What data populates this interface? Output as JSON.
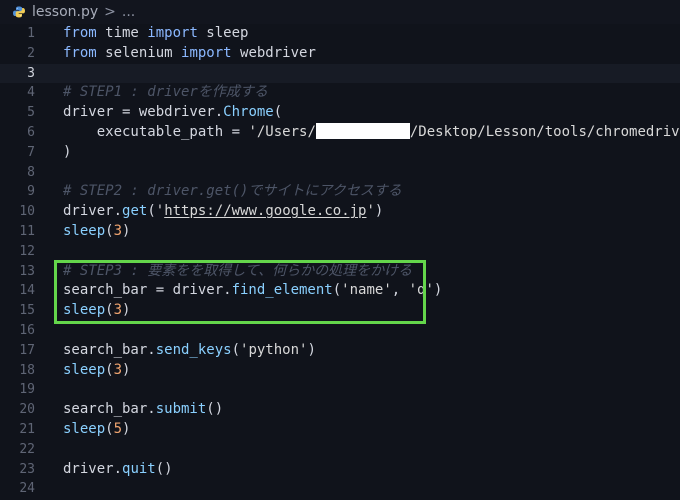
{
  "breadcrumb": {
    "file_name": "lesson.py",
    "separator": ">",
    "more": "..."
  },
  "editor": {
    "current_line": 3,
    "lines": [
      {
        "n": "1",
        "tokens": [
          {
            "t": "from",
            "c": "kw"
          },
          {
            "t": " time ",
            "c": "plain"
          },
          {
            "t": "import",
            "c": "kw"
          },
          {
            "t": " sleep",
            "c": "plain"
          }
        ]
      },
      {
        "n": "2",
        "tokens": [
          {
            "t": "from",
            "c": "kw"
          },
          {
            "t": " selenium ",
            "c": "plain"
          },
          {
            "t": "import",
            "c": "kw"
          },
          {
            "t": " webdriver",
            "c": "plain"
          }
        ]
      },
      {
        "n": "3",
        "tokens": [
          {
            "t": "",
            "c": "plain"
          }
        ]
      },
      {
        "n": "4",
        "tokens": [
          {
            "t": "# STEP1 : driverを作成する",
            "c": "cm"
          }
        ]
      },
      {
        "n": "5",
        "tokens": [
          {
            "t": "driver = webdriver.",
            "c": "plain"
          },
          {
            "t": "Chrome",
            "c": "fn"
          },
          {
            "t": "(",
            "c": "plain"
          }
        ]
      },
      {
        "n": "6",
        "tokens": [
          {
            "t": "    executable_path = ",
            "c": "plain"
          },
          {
            "t": "'/Users/",
            "c": "str"
          },
          {
            "t": "[REDACTED]",
            "c": "redact"
          },
          {
            "t": "/Desktop/Lesson/tools/chromedriver'",
            "c": "str"
          }
        ]
      },
      {
        "n": "7",
        "tokens": [
          {
            "t": ")",
            "c": "plain"
          }
        ]
      },
      {
        "n": "8",
        "tokens": [
          {
            "t": "",
            "c": "plain"
          }
        ]
      },
      {
        "n": "9",
        "tokens": [
          {
            "t": "# STEP2 : driver.get()でサイトにアクセスする",
            "c": "cm"
          }
        ]
      },
      {
        "n": "10",
        "tokens": [
          {
            "t": "driver.",
            "c": "plain"
          },
          {
            "t": "get",
            "c": "fn"
          },
          {
            "t": "(",
            "c": "plain"
          },
          {
            "t": "'",
            "c": "str"
          },
          {
            "t": "https://www.google.co.jp",
            "c": "url"
          },
          {
            "t": "'",
            "c": "str"
          },
          {
            "t": ")",
            "c": "plain"
          }
        ]
      },
      {
        "n": "11",
        "tokens": [
          {
            "t": "sleep",
            "c": "fn"
          },
          {
            "t": "(",
            "c": "plain"
          },
          {
            "t": "3",
            "c": "num"
          },
          {
            "t": ")",
            "c": "plain"
          }
        ]
      },
      {
        "n": "12",
        "tokens": [
          {
            "t": "",
            "c": "plain"
          }
        ]
      },
      {
        "n": "13",
        "tokens": [
          {
            "t": "# STEP3 : 要素をを取得して、何らかの処理をかける",
            "c": "cm"
          }
        ]
      },
      {
        "n": "14",
        "tokens": [
          {
            "t": "search_bar = driver.",
            "c": "plain"
          },
          {
            "t": "find_element",
            "c": "fn"
          },
          {
            "t": "(",
            "c": "plain"
          },
          {
            "t": "'name'",
            "c": "str"
          },
          {
            "t": ", ",
            "c": "plain"
          },
          {
            "t": "'q'",
            "c": "str"
          },
          {
            "t": ")",
            "c": "plain"
          }
        ]
      },
      {
        "n": "15",
        "tokens": [
          {
            "t": "sleep",
            "c": "fn"
          },
          {
            "t": "(",
            "c": "plain"
          },
          {
            "t": "3",
            "c": "num"
          },
          {
            "t": ")",
            "c": "plain"
          }
        ]
      },
      {
        "n": "16",
        "tokens": [
          {
            "t": "",
            "c": "plain"
          }
        ]
      },
      {
        "n": "17",
        "tokens": [
          {
            "t": "search_bar.",
            "c": "plain"
          },
          {
            "t": "send_keys",
            "c": "fn"
          },
          {
            "t": "(",
            "c": "plain"
          },
          {
            "t": "'python'",
            "c": "str"
          },
          {
            "t": ")",
            "c": "plain"
          }
        ]
      },
      {
        "n": "18",
        "tokens": [
          {
            "t": "sleep",
            "c": "fn"
          },
          {
            "t": "(",
            "c": "plain"
          },
          {
            "t": "3",
            "c": "num"
          },
          {
            "t": ")",
            "c": "plain"
          }
        ]
      },
      {
        "n": "19",
        "tokens": [
          {
            "t": "",
            "c": "plain"
          }
        ]
      },
      {
        "n": "20",
        "tokens": [
          {
            "t": "search_bar.",
            "c": "plain"
          },
          {
            "t": "submit",
            "c": "fn"
          },
          {
            "t": "()",
            "c": "plain"
          }
        ]
      },
      {
        "n": "21",
        "tokens": [
          {
            "t": "sleep",
            "c": "fn"
          },
          {
            "t": "(",
            "c": "plain"
          },
          {
            "t": "5",
            "c": "num"
          },
          {
            "t": ")",
            "c": "plain"
          }
        ]
      },
      {
        "n": "22",
        "tokens": [
          {
            "t": "",
            "c": "plain"
          }
        ]
      },
      {
        "n": "23",
        "tokens": [
          {
            "t": "driver.",
            "c": "plain"
          },
          {
            "t": "quit",
            "c": "fn"
          },
          {
            "t": "()",
            "c": "plain"
          }
        ]
      },
      {
        "n": "24",
        "tokens": [
          {
            "t": "",
            "c": "plain"
          }
        ]
      }
    ]
  },
  "colors": {
    "background": "#10131b",
    "highlight_box": "#64d64b",
    "keyword": "#8bb8ff",
    "function": "#8ad0ff",
    "number": "#f0a46f",
    "comment": "#4d5567"
  },
  "icons": {
    "file_type": "python-icon"
  }
}
